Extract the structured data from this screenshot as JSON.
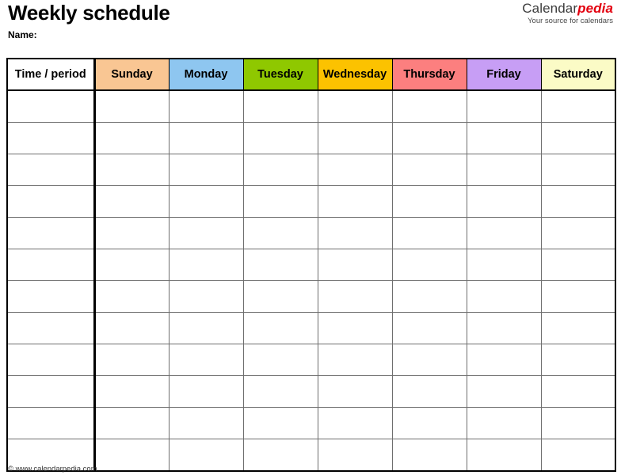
{
  "document": {
    "title": "Weekly schedule",
    "name_label": "Name:"
  },
  "brand": {
    "word_primary": "Calendar",
    "word_accent": "pedia",
    "tagline": "Your source for calendars",
    "primary_color": "#3c3c3c",
    "accent_color": "#e3000f"
  },
  "table": {
    "columns": [
      {
        "label": "Time / period",
        "color": "#ffffff"
      },
      {
        "label": "Sunday",
        "color": "#f9c693"
      },
      {
        "label": "Monday",
        "color": "#8ec6f0"
      },
      {
        "label": "Tuesday",
        "color": "#8fc800"
      },
      {
        "label": "Wednesday",
        "color": "#fcc200"
      },
      {
        "label": "Thursday",
        "color": "#fc7f7f"
      },
      {
        "label": "Friday",
        "color": "#c79ef5"
      },
      {
        "label": "Saturday",
        "color": "#fbfbc6"
      }
    ],
    "row_count": 12,
    "rows": [
      {
        "time": "",
        "cells": [
          "",
          "",
          "",
          "",
          "",
          "",
          ""
        ]
      },
      {
        "time": "",
        "cells": [
          "",
          "",
          "",
          "",
          "",
          "",
          ""
        ]
      },
      {
        "time": "",
        "cells": [
          "",
          "",
          "",
          "",
          "",
          "",
          ""
        ]
      },
      {
        "time": "",
        "cells": [
          "",
          "",
          "",
          "",
          "",
          "",
          ""
        ]
      },
      {
        "time": "",
        "cells": [
          "",
          "",
          "",
          "",
          "",
          "",
          ""
        ]
      },
      {
        "time": "",
        "cells": [
          "",
          "",
          "",
          "",
          "",
          "",
          ""
        ]
      },
      {
        "time": "",
        "cells": [
          "",
          "",
          "",
          "",
          "",
          "",
          ""
        ]
      },
      {
        "time": "",
        "cells": [
          "",
          "",
          "",
          "",
          "",
          "",
          ""
        ]
      },
      {
        "time": "",
        "cells": [
          "",
          "",
          "",
          "",
          "",
          "",
          ""
        ]
      },
      {
        "time": "",
        "cells": [
          "",
          "",
          "",
          "",
          "",
          "",
          ""
        ]
      },
      {
        "time": "",
        "cells": [
          "",
          "",
          "",
          "",
          "",
          "",
          ""
        ]
      },
      {
        "time": "",
        "cells": [
          "",
          "",
          "",
          "",
          "",
          "",
          ""
        ]
      }
    ]
  },
  "footer": {
    "copyright": "© www.calendarpedia.com"
  }
}
